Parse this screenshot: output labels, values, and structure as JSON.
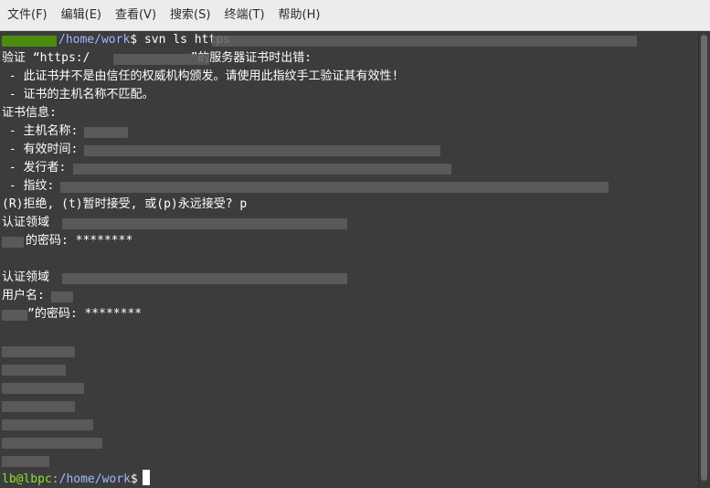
{
  "menu": [
    {
      "label": "文件(F)"
    },
    {
      "label": "编辑(E)"
    },
    {
      "label": "查看(V)"
    },
    {
      "label": "搜索(S)"
    },
    {
      "label": "终端(T)"
    },
    {
      "label": "帮助(H)"
    }
  ],
  "terminal": {
    "cmd_path": "/home/work",
    "cmd_text": "$ svn ls https",
    "verify_prefix": "验证 “https:/",
    "verify_suffix": "”的服务器证书时出错:",
    "err1": " - 此证书并不是由信任的权威机构颁发。请使用此指纹手工验证其有效性!",
    "err2": " - 证书的主机名称不匹配。",
    "cert_info": "证书信息:",
    "host": " - 主机名称:",
    "valid": " - 有效时间:",
    "issuer": " - 发行者:",
    "fingerprint": " - 指纹:",
    "prompt_accept": "(R)拒绝, (t)暂时接受, 或(p)永远接受? p",
    "realm1": "认证领域",
    "password1": "的密码: ********",
    "realm2": "认证领域",
    "username": "用户名:",
    "password2": "”的密码: ********",
    "final_user": "lb@lbpc",
    "final_path": ":/home/work",
    "final_dollar": "$"
  },
  "colors": {
    "background": "#3c3c3c",
    "prompt_green": "#8ae234",
    "path_blue": "#9db9ff",
    "text": "#ffffff"
  }
}
